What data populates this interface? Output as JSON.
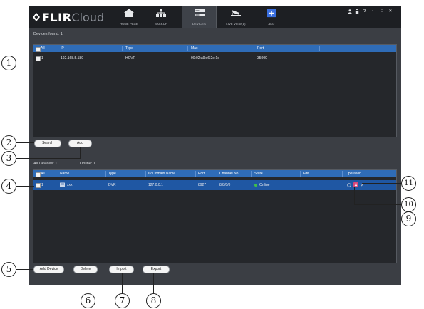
{
  "app": {
    "logo_brand": "FLIR",
    "logo_product": "Cloud"
  },
  "nav": [
    {
      "label": "HOME PAGE",
      "icon": "home-icon"
    },
    {
      "label": "BACKUP",
      "icon": "backup-icon"
    },
    {
      "label": "DEVICES",
      "icon": "devices-icon",
      "active": true
    },
    {
      "label": "LIVE VIEW(1)",
      "icon": "live-view-icon"
    },
    {
      "label": "ADD",
      "icon": "add-icon"
    }
  ],
  "window_controls": {
    "user": "user-icon",
    "lock": "lock-icon",
    "help": "?",
    "minimize": "-",
    "maximize": "□",
    "close": "×"
  },
  "found": {
    "label": "Devices found: 1",
    "columns": [
      "All",
      "IP",
      "Type",
      "Mac",
      "Port"
    ],
    "rows": [
      {
        "index": "1",
        "ip": "192.168.5.189",
        "type": "HCVR",
        "mac": "90:02:a9:c6:2e:1e",
        "port": "35000"
      }
    ]
  },
  "found_buttons": {
    "search": "Search",
    "add": "Add"
  },
  "devices": {
    "all_label": "All Devices: 1",
    "online_label": "Online: 1",
    "columns": [
      "All",
      "Name",
      "Type",
      "IP/Domain Name",
      "Port",
      "Channel No.",
      "State",
      "Edit",
      "Operation"
    ],
    "rows": [
      {
        "index": "1",
        "name": "xxx",
        "type": "DVR",
        "ip": "127.0.0.1",
        "port": "8927",
        "channels": "8/8/0/0",
        "state": "Online"
      }
    ]
  },
  "device_buttons": {
    "add_device": "Add Device",
    "delete": "Delete",
    "import": "Import",
    "export": "Export"
  },
  "callouts": [
    "1",
    "2",
    "3",
    "4",
    "5",
    "6",
    "7",
    "8",
    "9",
    "10",
    "11"
  ],
  "colors": {
    "header_bar": "#1d1f23",
    "table_header": "#2f6cb7",
    "selected_row": "#1f57a3",
    "online": "#3fbf4a",
    "add_accent": "#3a6fe0"
  }
}
